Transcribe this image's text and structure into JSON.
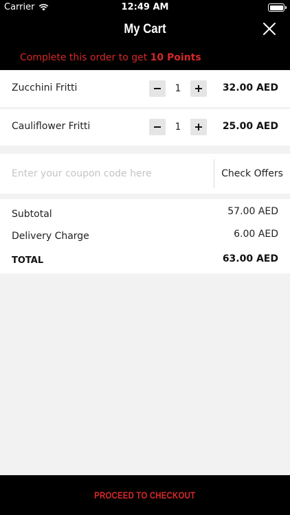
{
  "status_bar": {
    "carrier": "Carrier",
    "time": "12:49 AM",
    "icons": [
      "wifi-icon",
      "battery-icon"
    ]
  },
  "header": {
    "title": "My Cart",
    "close_icon": "close-icon",
    "points_prefix": "Complete this order to get ",
    "points_value": "10 Points"
  },
  "cart": {
    "items": [
      {
        "name": "Zucchini Fritti",
        "quantity": "1",
        "price": "32.00 AED"
      },
      {
        "name": "Cauliflower Fritti",
        "quantity": "1",
        "price": "25.00 AED"
      }
    ],
    "decrease_icon": "minus-icon",
    "increase_icon": "plus-icon"
  },
  "coupon": {
    "placeholder": "Enter your coupon code here",
    "value": "",
    "check_offers_label": "Check Offers"
  },
  "summary": {
    "subtotal_label": "Subtotal",
    "subtotal_value": "57.00 AED",
    "delivery_label": "Delivery Charge",
    "delivery_value": "6.00 AED",
    "total_label": "TOTAL",
    "total_value": "63.00 AED"
  },
  "checkout": {
    "label": "PROCEED TO CHECKOUT"
  },
  "colors": {
    "accent_red": "#d62828",
    "header_bg": "#000000",
    "page_bg": "#f2f2f2"
  }
}
